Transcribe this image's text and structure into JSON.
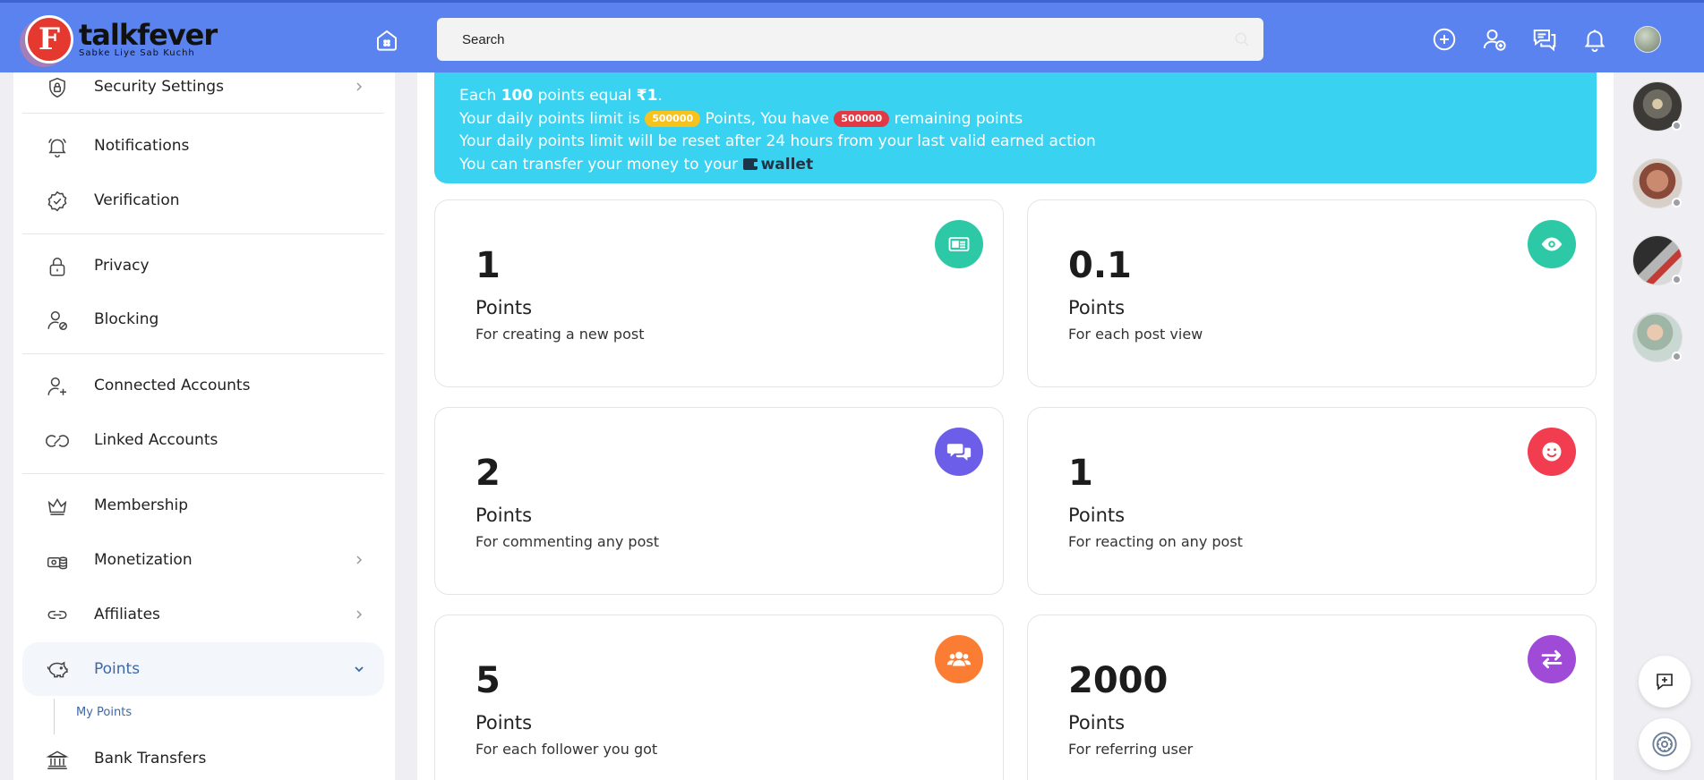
{
  "app": {
    "logo_letter": "F",
    "name_part1": "talk",
    "name_part2": "fever",
    "tagline": "Sabke Liye Sab Kuchh"
  },
  "header": {
    "search_placeholder": "Search",
    "icons": [
      "home-icon",
      "search-icon",
      "add-circle-icon",
      "add-user-icon",
      "messages-icon",
      "bell-icon",
      "avatar"
    ],
    "accent_color": "#5a83ef"
  },
  "sidebar": {
    "items": [
      {
        "label": "Security Settings",
        "icon": "shield-lock-icon",
        "chevron": "right"
      },
      {
        "label": "Notifications",
        "icon": "bell-icon"
      },
      {
        "label": "Verification",
        "icon": "badge-check-icon"
      },
      {
        "label": "Privacy",
        "icon": "lock-icon"
      },
      {
        "label": "Blocking",
        "icon": "user-block-icon"
      },
      {
        "label": "Connected Accounts",
        "icon": "user-plus-icon"
      },
      {
        "label": "Linked Accounts",
        "icon": "link-icon"
      },
      {
        "label": "Membership",
        "icon": "crown-icon"
      },
      {
        "label": "Monetization",
        "icon": "money-icon",
        "chevron": "right"
      },
      {
        "label": "Affiliates",
        "icon": "affiliate-link-icon",
        "chevron": "right"
      },
      {
        "label": "Points",
        "icon": "piggy-bank-icon",
        "chevron": "down",
        "active": true
      },
      {
        "label": "Bank Transfers",
        "icon": "bank-icon"
      }
    ],
    "sub_item": "My Points",
    "active_color": "#3d68a8"
  },
  "banner": {
    "line1_pre": "Each ",
    "line1_bold": "100",
    "line1_mid": " points equal ",
    "line1_currency": "₹1",
    "line1_end": ".",
    "line2_pre": "Your daily points limit is ",
    "line2_limit": "500000",
    "line2_mid": " Points, You have ",
    "line2_remaining": "500000",
    "line2_end": " remaining points",
    "line3": "Your daily points limit will be reset after 24 hours from your last valid earned action",
    "line4_pre": "You can transfer your money to your ",
    "line4_link": "wallet",
    "color": "#39d2f0"
  },
  "cards": [
    {
      "value": "1",
      "unit": "Points",
      "desc": "For creating a new post",
      "icon": "newspaper-icon",
      "color": "#2dc9a6"
    },
    {
      "value": "0.1",
      "unit": "Points",
      "desc": "For each post view",
      "icon": "eye-icon",
      "color": "#2dc9a6"
    },
    {
      "value": "2",
      "unit": "Points",
      "desc": "For commenting any post",
      "icon": "comments-icon",
      "color": "#6c5ee8"
    },
    {
      "value": "1",
      "unit": "Points",
      "desc": "For reacting on any post",
      "icon": "smile-icon",
      "color": "#f23c50"
    },
    {
      "value": "5",
      "unit": "Points",
      "desc": "For each follower you got",
      "icon": "users-icon",
      "color": "#fb7d33"
    },
    {
      "value": "2000",
      "unit": "Points",
      "desc": "For referring user",
      "icon": "exchange-icon",
      "color": "#a04ad8"
    }
  ],
  "right_rail": {
    "avatars": [
      "online-user-avatar-1",
      "online-user-avatar-2",
      "online-user-avatar-3",
      "online-user-avatar-4"
    ],
    "buttons": [
      "new-chat-icon",
      "settings-gear-icon"
    ]
  }
}
